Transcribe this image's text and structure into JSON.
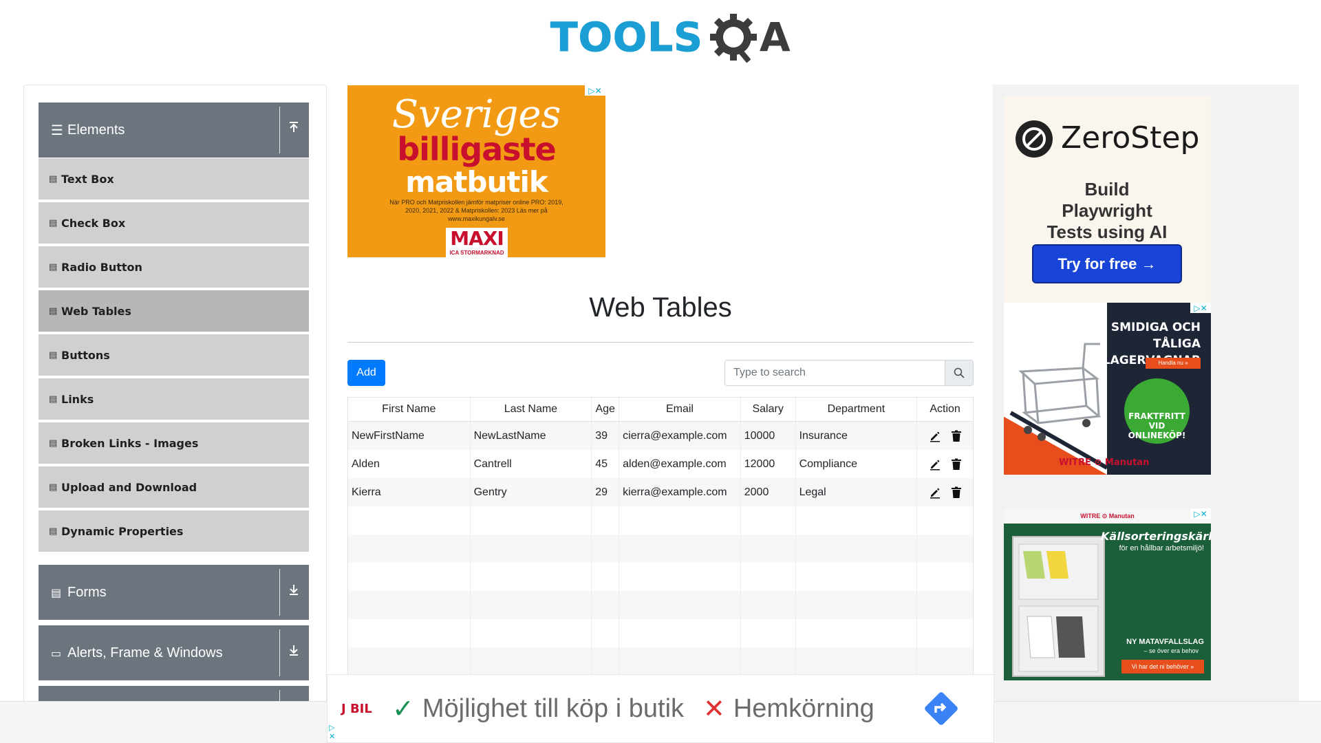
{
  "header": {
    "logo_text_left": "TOOLS",
    "logo_text_right": "A"
  },
  "sidebar": {
    "elements_group": {
      "label": "Elements",
      "toggle_icon": "collapse-arrow-up"
    },
    "items": [
      {
        "label": "Text Box"
      },
      {
        "label": "Check Box"
      },
      {
        "label": "Radio Button"
      },
      {
        "label": "Web Tables",
        "active": true
      },
      {
        "label": "Buttons"
      },
      {
        "label": "Links"
      },
      {
        "label": "Broken Links - Images"
      },
      {
        "label": "Upload and Download"
      },
      {
        "label": "Dynamic Properties"
      }
    ],
    "forms_group": {
      "label": "Forms"
    },
    "alerts_group": {
      "label": "Alerts, Frame & Windows"
    }
  },
  "ad_top": {
    "line1": "Sveriges",
    "line2": "billigaste",
    "line3": "matbutik",
    "small": "När PRO och Matpriskollen jämför matpriser online PRO: 2019, 2020, 2021, 2022 & Matpriskollen: 2023 Läs mer på www.maxikungalv.se",
    "brand": "MAXI",
    "brand_sub": "ICA STORMARKNAD"
  },
  "main": {
    "title": "Web Tables",
    "add_label": "Add",
    "search_placeholder": "Type to search"
  },
  "table": {
    "headers": [
      "First Name",
      "Last Name",
      "Age",
      "Email",
      "Salary",
      "Department",
      "Action"
    ],
    "rows": [
      [
        "NewFirstName",
        "NewLastName",
        "39",
        "cierra@example.com",
        "10000",
        "Insurance"
      ],
      [
        "Alden",
        "Cantrell",
        "45",
        "alden@example.com",
        "12000",
        "Compliance"
      ],
      [
        "Kierra",
        "Gentry",
        "29",
        "kierra@example.com",
        "2000",
        "Legal"
      ]
    ]
  },
  "ad_zerostep": {
    "name": "ZeroStep",
    "tagline": "Build Playwright Tests using AI",
    "button": "Try for free →"
  },
  "ad_cart": {
    "headline": "SMIDIGA OCH TÅLIGA LAGERVAGNAR",
    "cta": "Handla nu »",
    "badge": "FRAKTFRITT VID ONLINEKÖP!",
    "brand": "WITRE ⊙ Manutan"
  },
  "ad_bins": {
    "brand": "WITRE ⊙ Manutan",
    "headline": "Källsorteringskärl",
    "sub": "för en hållbar arbetsmiljö!",
    "news": "NY MATAVFALLSLAG",
    "news_sub": "– se över era behov",
    "cta": "Vi har det ni behöver »"
  },
  "bottom_ad": {
    "brand": "J BIL",
    "yes_text": "Möjlighet till köp i butik",
    "no_text": "Hemkörning"
  }
}
